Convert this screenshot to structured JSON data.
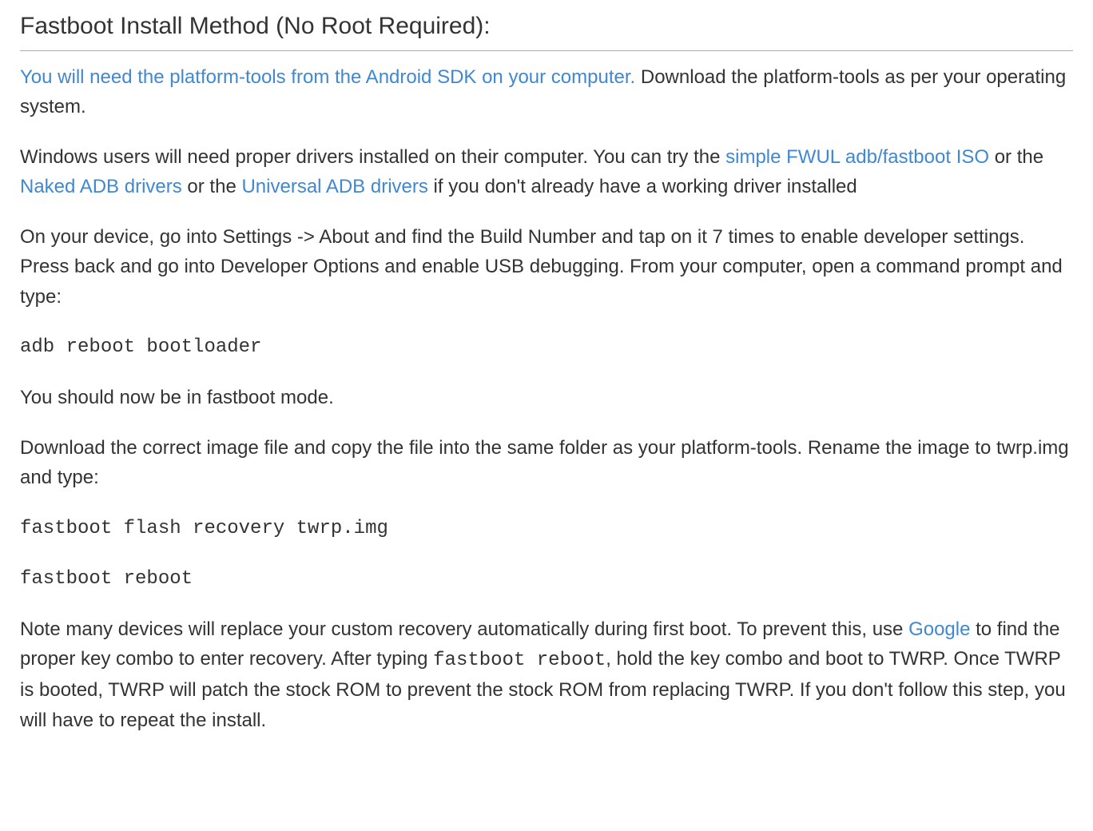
{
  "heading": "Fastboot Install Method (No Root Required):",
  "p1": {
    "link": "You will need the platform-tools from the Android SDK on your computer.",
    "rest": " Download the platform-tools as per your operating system."
  },
  "p2": {
    "pre": "Windows users will need proper drivers installed on their computer. You can try the ",
    "link1": "simple FWUL adb/fastboot ISO",
    "mid1": " or the ",
    "link2": "Naked ADB drivers",
    "mid2": " or the ",
    "link3": "Universal ADB drivers",
    "post": " if you don't already have a working driver installed"
  },
  "p3": "On your device, go into Settings -> About and find the Build Number and tap on it 7 times to enable developer settings. Press back and go into Developer Options and enable USB debugging. From your computer, open a command prompt and type:",
  "cmd1": "adb reboot bootloader",
  "p4": "You should now be in fastboot mode.",
  "p5": "Download the correct image file and copy the file into the same folder as your platform-tools. Rename the image to twrp.img and type:",
  "cmd2": "fastboot flash recovery twrp.img",
  "cmd3": "fastboot reboot",
  "p6": {
    "pre": "Note many devices will replace your custom recovery automatically during first boot. To prevent this, use ",
    "link": "Google",
    "mid": " to find the proper key combo to enter recovery. After typing ",
    "code": "fastboot reboot",
    "post": ", hold the key combo and boot to TWRP. Once TWRP is booted, TWRP will patch the stock ROM to prevent the stock ROM from replacing TWRP. If you don't follow this step, you will have to repeat the install."
  }
}
